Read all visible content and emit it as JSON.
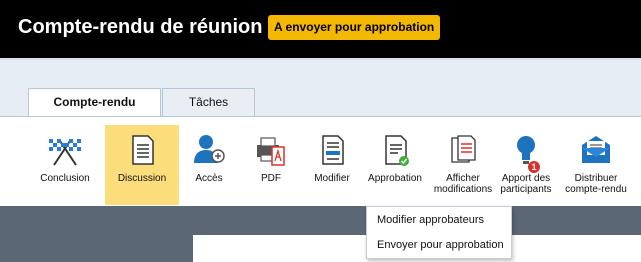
{
  "header": {
    "title": "Compte-rendu de réunion",
    "status_badge": "A envoyer pour approbation"
  },
  "tabs": [
    {
      "label": "Compte-rendu",
      "active": true
    },
    {
      "label": "Tâches",
      "active": false
    }
  ],
  "toolbar": {
    "items": [
      {
        "label": "Conclusion",
        "icon": "checkered-flags-icon"
      },
      {
        "label": "Discussion",
        "icon": "document-icon",
        "selected": true
      },
      {
        "label": "Accès",
        "icon": "user-add-icon"
      },
      {
        "label": "PDF",
        "icon": "pdf-print-icon"
      },
      {
        "label": "Modifier",
        "icon": "edit-document-icon"
      },
      {
        "label": "Approbation",
        "icon": "approval-document-icon"
      },
      {
        "label": "Afficher modifications",
        "icon": "show-changes-icon"
      },
      {
        "label": "Apport des participants",
        "icon": "lightbulb-icon",
        "badge": "1"
      },
      {
        "label": "Distribuer compte-rendu",
        "icon": "envelope-icon"
      }
    ]
  },
  "dropdown": {
    "items": [
      "Modifier approbateurs",
      "Envoyer pour approbation"
    ]
  },
  "colors": {
    "header_bg": "#000000",
    "badge_bg": "#f5b800",
    "selected_bg": "#fbdd7c",
    "workspace_bg": "#5c6775",
    "accent_blue": "#1e73be",
    "notification_red": "#d9302c"
  }
}
